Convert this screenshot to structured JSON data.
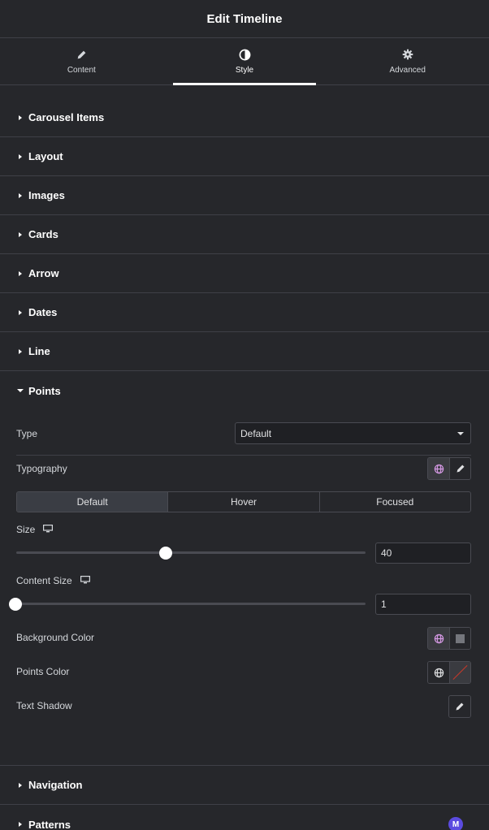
{
  "header": {
    "title": "Edit Timeline"
  },
  "tabs": [
    {
      "label": "Content",
      "icon": "pencil-icon"
    },
    {
      "label": "Style",
      "icon": "half-circle-icon",
      "active": true
    },
    {
      "label": "Advanced",
      "icon": "gear-icon"
    }
  ],
  "sections": [
    {
      "label": "Carousel Items"
    },
    {
      "label": "Layout"
    },
    {
      "label": "Images"
    },
    {
      "label": "Cards"
    },
    {
      "label": "Arrow"
    },
    {
      "label": "Dates"
    },
    {
      "label": "Line"
    }
  ],
  "points": {
    "title": "Points",
    "type_label": "Type",
    "type_value": "Default",
    "typography_label": "Typography",
    "state_tabs": [
      "Default",
      "Hover",
      "Focused"
    ],
    "size_label": "Size",
    "size_value": "40",
    "content_size_label": "Content Size",
    "content_size_value": "1",
    "bg_color_label": "Background Color",
    "points_color_label": "Points Color",
    "text_shadow_label": "Text Shadow"
  },
  "bottom_sections": [
    {
      "label": "Navigation"
    },
    {
      "label": "Patterns"
    }
  ],
  "badge": {
    "letter": "M"
  },
  "colors": {
    "panel": "#26272b",
    "divider": "#3f4047",
    "badge": "#5b4be0",
    "globe_active": "#d99be8"
  }
}
